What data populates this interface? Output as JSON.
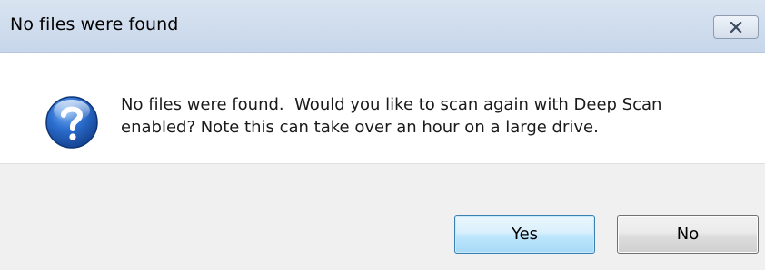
{
  "window": {
    "title": "No files were found",
    "close_icon": "close-icon"
  },
  "message": {
    "icon": "question-icon",
    "text": "No files were found.  Would you like to scan again with Deep Scan\nenabled? Note this can take over an hour on a large drive."
  },
  "buttons": {
    "yes_label": "Yes",
    "no_label": "No"
  },
  "colors": {
    "title_bar": "#c7d6ea",
    "footer": "#f0f0f0",
    "default_button_border": "#3c7fb1",
    "icon_blue": "#1f5fb8"
  }
}
